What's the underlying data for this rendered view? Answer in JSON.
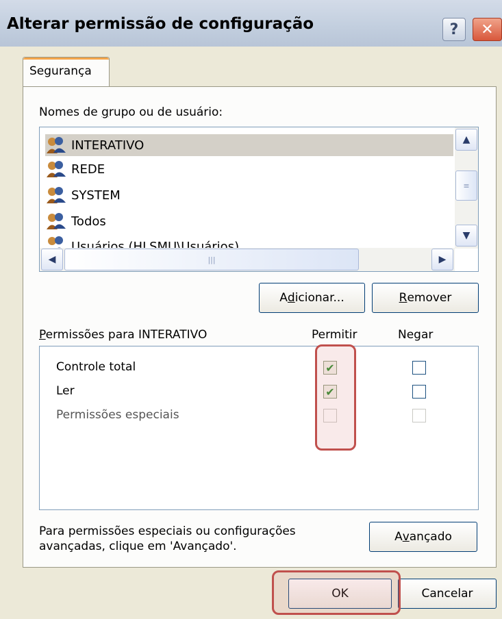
{
  "window": {
    "title": "Alterar permissão de configuração",
    "help_label": "?",
    "close_label": "✕"
  },
  "tabs": [
    {
      "label": "Segurança"
    }
  ],
  "groups": {
    "label_pre": "Nomes de ",
    "label_acc": "g",
    "label_post": "rupo ou de usuário:",
    "items": [
      {
        "label": "INTERATIVO",
        "selected": true
      },
      {
        "label": "REDE"
      },
      {
        "label": "SYSTEM"
      },
      {
        "label": "Todos"
      },
      {
        "label": "Usuários (HLSMU\\Usuários)"
      }
    ],
    "add_pre": "A",
    "add_acc": "d",
    "add_post": "icionar...",
    "remove_acc": "R",
    "remove_post": "emover"
  },
  "permissions": {
    "label_acc": "P",
    "label_post": "ermissões para INTERATIVO",
    "allow_header": "Permitir",
    "deny_header": "Negar",
    "rows": [
      {
        "name": "Controle total",
        "allow": true,
        "deny": false
      },
      {
        "name": "Ler",
        "allow": true,
        "deny": false
      },
      {
        "name": "Permissões especiais",
        "allow": false,
        "deny": false,
        "disabled": true
      }
    ]
  },
  "advanced": {
    "text_line1": "Para permissões especiais ou configurações",
    "text_line2": "avançadas, clique em 'Avançado'.",
    "button_pre": "A",
    "button_acc": "v",
    "button_post": "ançado"
  },
  "footer": {
    "ok_label": "OK",
    "cancel_label": "Cancelar"
  },
  "colors": {
    "highlight": "#c0504d",
    "dialog_bg": "#ece9d8",
    "selection": "#d4d0c8"
  }
}
